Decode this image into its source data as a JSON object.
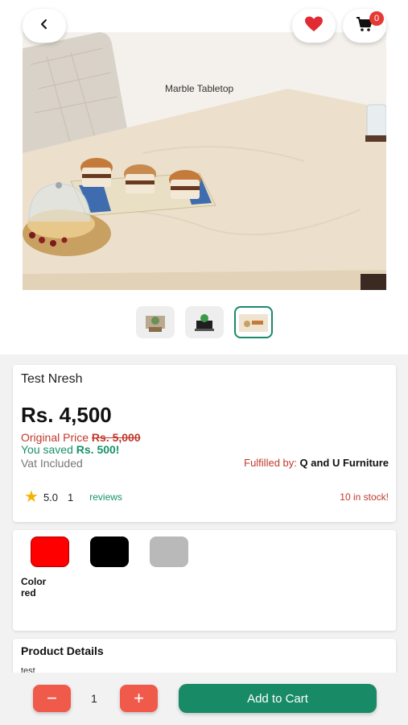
{
  "header": {
    "back_icon": "chevron-left-icon",
    "favorite_icon": "heart-icon",
    "cart_icon": "cart-icon",
    "cart_count": "0",
    "heart_color": "#e02b35"
  },
  "hero": {
    "caption": "Marble Tabletop",
    "thumbnails": [
      "thumbnail-1",
      "thumbnail-2",
      "thumbnail-3"
    ],
    "active_thumbnail": 3
  },
  "product": {
    "name": "Test Nresh",
    "price": "Rs. 4,500",
    "original_price_label": "Original Price ",
    "original_price": "Rs. 5,000",
    "saved_label": "You saved ",
    "saved_amount": "Rs. 500!",
    "vat": "Vat Included",
    "fulfilled_label": "Fulfilled by: ",
    "fulfilled_by": "Q and U Furniture",
    "rating": "5.0",
    "review_count": "1",
    "reviews_label": "reviews",
    "stock": "10 in stock!"
  },
  "colors": {
    "swatches": [
      {
        "name": "red",
        "hex": "#ff0000"
      },
      {
        "name": "black",
        "hex": "#000000"
      },
      {
        "name": "grey",
        "hex": "#b9b9b9"
      }
    ],
    "label": "Color",
    "selected": "red"
  },
  "details": {
    "title": "Product Details",
    "text": "test"
  },
  "bottom_bar": {
    "minus_label": "−",
    "quantity": "1",
    "plus_label": "+",
    "add_to_cart": "Add to Cart",
    "accent_color": "#188a66",
    "qty_button_color": "#f05a4a"
  }
}
